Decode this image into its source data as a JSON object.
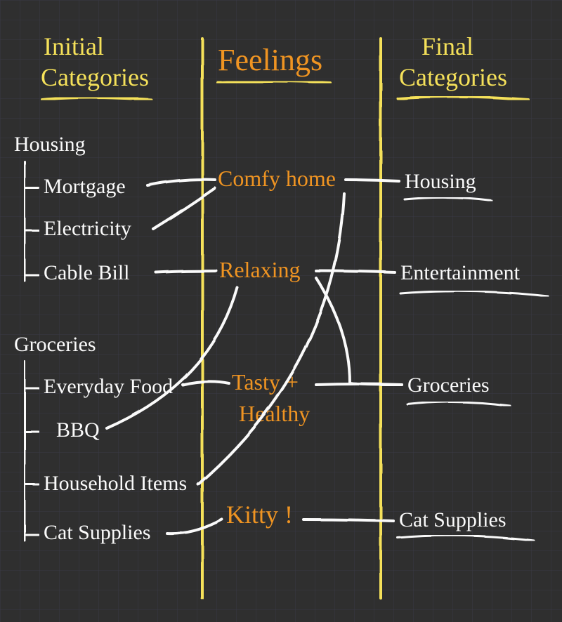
{
  "headers": {
    "left_line1": "Initial",
    "left_line2": "Categories",
    "middle": "Feelings",
    "right_line1": "Final",
    "right_line2": "Categories"
  },
  "initial": {
    "group1": {
      "title": "Housing",
      "items": [
        "Mortgage",
        "Electricity",
        "Cable Bill"
      ]
    },
    "group2": {
      "title": "Groceries",
      "items": [
        "Everyday Food",
        "BBQ",
        "Household Items",
        "Cat Supplies"
      ]
    }
  },
  "feelings": [
    "Comfy home",
    "Relaxing",
    "Tasty +",
    "Healthy",
    "Kitty !"
  ],
  "final": [
    "Housing",
    "Entertainment",
    "Groceries",
    "Cat Supplies"
  ],
  "colors": {
    "bg": "#2f2f2f",
    "grid": "#3a3a44",
    "yellow": "#f5e15a",
    "orange": "#ef9422",
    "white": "#fafafa"
  }
}
